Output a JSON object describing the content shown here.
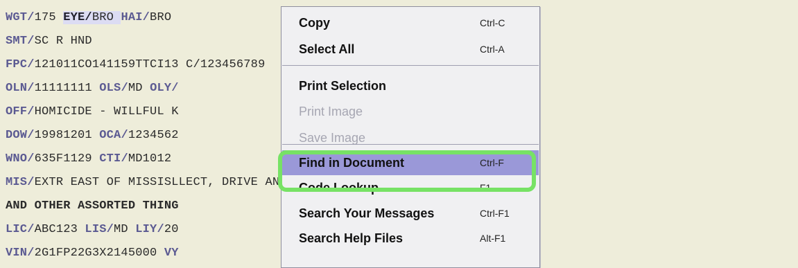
{
  "record": {
    "lines": [
      [
        {
          "f": "WGT/",
          "v": "175 "
        },
        {
          "f": "EYE/",
          "v": "BRO ",
          "hl": true
        },
        {
          "f": "HAI/",
          "v": "BRO"
        }
      ],
      [
        {
          "f": "SMT/",
          "v": "SC R HND"
        }
      ],
      [
        {
          "f": "FPC/",
          "v": "121011CO141159TTCI13 "
        },
        {
          "f": "",
          "v": "C/123456789"
        }
      ],
      [
        {
          "f": "OLN/",
          "v": "11111111 "
        },
        {
          "f": "OLS/",
          "v": "MD "
        },
        {
          "f": "OLY/",
          "v": ""
        }
      ],
      [
        {
          "f": "OFF/",
          "v": "HOMICIDE - WILLFUL K"
        }
      ],
      [
        {
          "f": "DOW/",
          "v": "19981201 "
        },
        {
          "f": "OCA/",
          "v": "1234562"
        }
      ],
      [
        {
          "f": "WNO/",
          "v": "635F1129 "
        },
        {
          "f": "CTI/",
          "v": "MD1012"
        }
      ],
      [
        {
          "f": "MIS/",
          "v": "EXTR EAST OF MISSIS"
        },
        {
          "f": "",
          "v": "LLECT, DRIVE AND STEA"
        }
      ],
      [
        {
          "f": "",
          "v": "AND OTHER ASSORTED THING",
          "bold": true
        }
      ],
      [
        {
          "f": "LIC/",
          "v": "ABC123 "
        },
        {
          "f": "LIS/",
          "v": "MD "
        },
        {
          "f": "LIY/",
          "v": "20"
        }
      ],
      [
        {
          "f": "VIN/",
          "v": "2G1FP22G3X2145000 "
        },
        {
          "f": "VY",
          "v": ""
        }
      ]
    ]
  },
  "context_menu": {
    "items": [
      {
        "label": "Copy",
        "shortcut": "Ctrl-C",
        "enabled": true
      },
      {
        "label": "Select All",
        "shortcut": "Ctrl-A",
        "enabled": true
      },
      {
        "separator": true
      },
      {
        "label": "Print Selection",
        "shortcut": "",
        "enabled": true
      },
      {
        "label": "Print Image",
        "shortcut": "",
        "enabled": false
      },
      {
        "label": "Save Image",
        "shortcut": "",
        "enabled": false
      },
      {
        "separator": true
      },
      {
        "label": "Find in Document",
        "shortcut": "Ctrl-F",
        "enabled": true,
        "selected": true
      },
      {
        "label": "Code Lookup",
        "shortcut": "F1",
        "enabled": true
      },
      {
        "label": "Search Your Messages",
        "shortcut": "Ctrl-F1",
        "enabled": true
      },
      {
        "label": "Search Help Files",
        "shortcut": "Alt-F1",
        "enabled": true
      }
    ]
  },
  "colors": {
    "background": "#eeedda",
    "field_label": "#5b5a92",
    "menu_bg": "#f0f0f2",
    "selected_item": "#9a98d8",
    "focus_ring": "#77e265"
  }
}
